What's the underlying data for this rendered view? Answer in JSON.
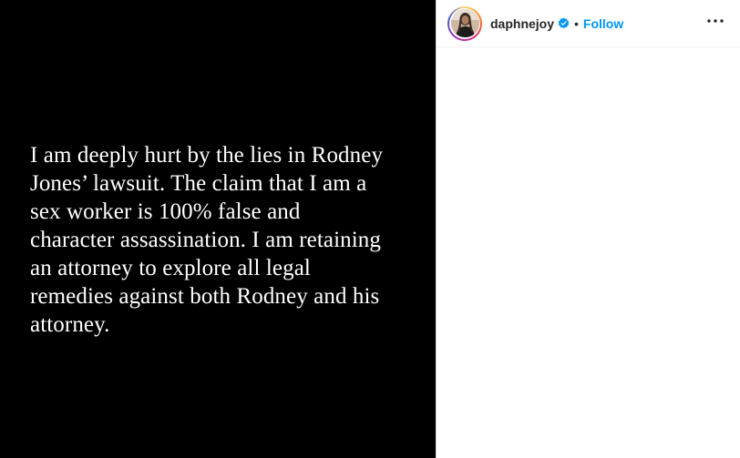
{
  "post": {
    "text_lines": [
      "I am deeply hurt by the lies in Rodney",
      "Jones’ lawsuit. The claim that I am a",
      "sex worker is 100% false and",
      "character assassination. I am retaining",
      "an attorney to explore all legal",
      "remedies against both Rodney and his",
      "attorney."
    ]
  },
  "header": {
    "username": "daphnejoy",
    "separator": "•",
    "follow_label": "Follow",
    "verified": true
  },
  "colors": {
    "media_background": "#000000",
    "text": "#ffffff",
    "follow": "#0095f6",
    "verified": "#0095f6"
  },
  "icons": {
    "avatar": "profile-avatar",
    "verified": "verified-badge-icon",
    "more": "more-options-icon"
  }
}
